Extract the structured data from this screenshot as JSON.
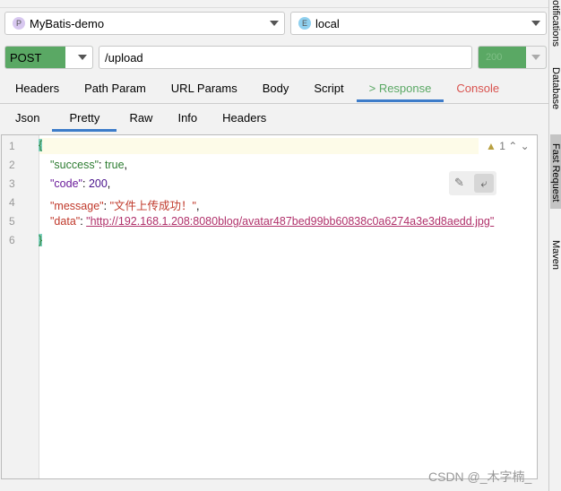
{
  "project": {
    "badge": "P",
    "name": "MyBatis-demo"
  },
  "env": {
    "badge": "E",
    "name": "local"
  },
  "request": {
    "method": "POST",
    "url": "/upload",
    "status": "200"
  },
  "tabs": [
    "Headers",
    "Path Param",
    "URL Params",
    "Body",
    "Script",
    "> Response",
    "Console"
  ],
  "subtabs": [
    "Json",
    "Pretty",
    "Raw",
    "Info",
    "Headers"
  ],
  "editor": {
    "lines": [
      "1",
      "2",
      "3",
      "4",
      "5",
      "6"
    ],
    "open": "{",
    "close": "}",
    "success_key": "\"success\"",
    "success_val": "true",
    "code_key": "\"code\"",
    "code_val": "200",
    "message_key": "\"message\"",
    "message_val": "\"文件上传成功！\"",
    "data_key": "\"data\"",
    "data_val": "\"http://192.168.1.208:8080blog/avatar487bed99bb60838c0a6274a3e3d8aedd.jpg\"",
    "warning_count": "1"
  },
  "sidebar": [
    "otifications",
    "Database",
    "Fast Request",
    "Maven"
  ],
  "watermark": "CSDN @_木字楠_",
  "colors": {
    "method": "#5aa864",
    "accent": "#3d7cc9",
    "response": "#5aa864",
    "console": "#d9534f",
    "string": "#c0392b",
    "key_green": "#2e7d32"
  }
}
